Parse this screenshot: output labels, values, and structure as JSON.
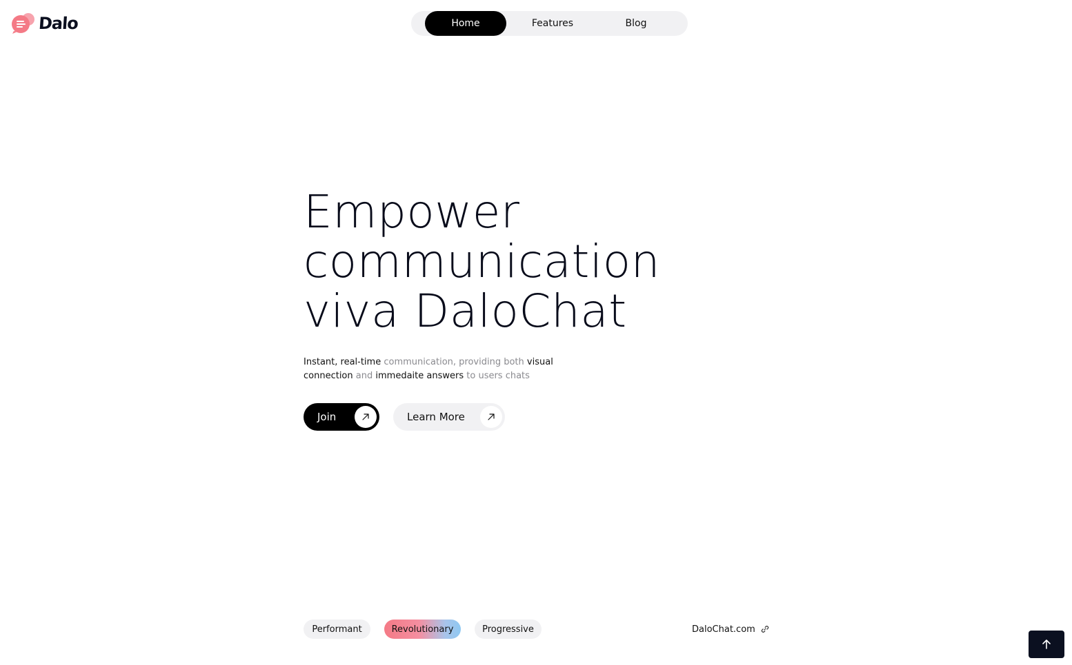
{
  "brand": {
    "name": "Dalo",
    "accent_color": "#f47a86",
    "logo_icon": "chat-bubble-icon"
  },
  "nav": {
    "items": [
      {
        "label": "Home",
        "active": true
      },
      {
        "label": "Features",
        "active": false
      },
      {
        "label": "Blog",
        "active": false
      }
    ]
  },
  "hero": {
    "headline": [
      "Empower",
      "communication",
      "viva DaloChat"
    ],
    "subtitle": {
      "parts": [
        {
          "text": "Instant, real-time",
          "emphasis": true
        },
        {
          "text": "communication, providing both",
          "emphasis": false
        },
        {
          "text": "visual connection",
          "emphasis": true
        },
        {
          "text": "and",
          "emphasis": false
        },
        {
          "text": "immedaite answers",
          "emphasis": true
        },
        {
          "text": "to users chats",
          "emphasis": false
        }
      ]
    },
    "buttons": {
      "join_label": "Join",
      "learn_more_label": "Learn More",
      "icon": "arrow-up-right-icon"
    }
  },
  "tags": [
    "Performant",
    "Revolutionary",
    "Progressive"
  ],
  "site_link": {
    "label": "DaloChat.com",
    "icon": "link-icon"
  },
  "scroll_top": {
    "icon": "arrow-up-icon"
  }
}
